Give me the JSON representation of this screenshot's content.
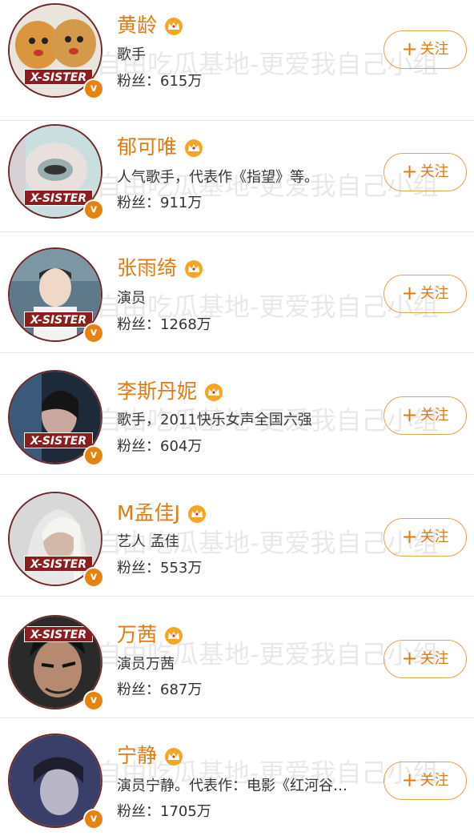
{
  "follow_label": "关注",
  "follow_plus": "+",
  "fans_prefix": "粉丝：",
  "badge_text": "X-SISTER",
  "v_badge": "v",
  "watermark_text": "自由吃瓜基地-更爱我自己小组",
  "colors": {
    "accent": "#e07b12",
    "badge": "#8c1d1d",
    "v": "#e6820e"
  },
  "users": [
    {
      "name": "黄龄",
      "desc": "歌手",
      "fans": "粉丝：615万"
    },
    {
      "name": "郁可唯",
      "desc": "人气歌手，代表作《指望》等。",
      "fans": "粉丝：911万"
    },
    {
      "name": "张雨绮",
      "desc": "演员",
      "fans": "粉丝：1268万"
    },
    {
      "name": "李斯丹妮",
      "desc": "歌手，2011快乐女声全国六强",
      "fans": "粉丝：604万"
    },
    {
      "name": "M孟佳J",
      "desc": "艺人 孟佳",
      "fans": "粉丝：553万"
    },
    {
      "name": "万茜",
      "desc": "演员万茜",
      "fans": "粉丝：687万"
    },
    {
      "name": "宁静",
      "desc": "演员宁静。代表作：电影《红河谷…",
      "fans": "粉丝：1705万"
    }
  ]
}
